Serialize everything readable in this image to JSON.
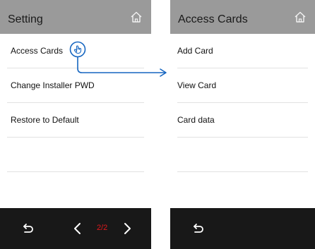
{
  "left_screen": {
    "title": "Setting",
    "menu": [
      {
        "label": "Access Cards"
      },
      {
        "label": "Change Installer PWD"
      },
      {
        "label": "Restore to Default"
      },
      {
        "label": ""
      },
      {
        "label": ""
      }
    ],
    "footer": {
      "page_indicator": "2/2"
    }
  },
  "right_screen": {
    "title": "Access Cards",
    "menu": [
      {
        "label": "Add Card"
      },
      {
        "label": "View Card"
      },
      {
        "label": "Card data"
      },
      {
        "label": ""
      },
      {
        "label": ""
      }
    ]
  },
  "colors": {
    "header_bg": "#9a9a9a",
    "footer_bg": "#181818",
    "accent_arrow": "#1565c0",
    "page_indicator": "#e0181c"
  },
  "icons": [
    "home-icon",
    "back-icon",
    "chevron-left-icon",
    "chevron-right-icon",
    "hand-pointer-icon",
    "arrow-icon"
  ]
}
